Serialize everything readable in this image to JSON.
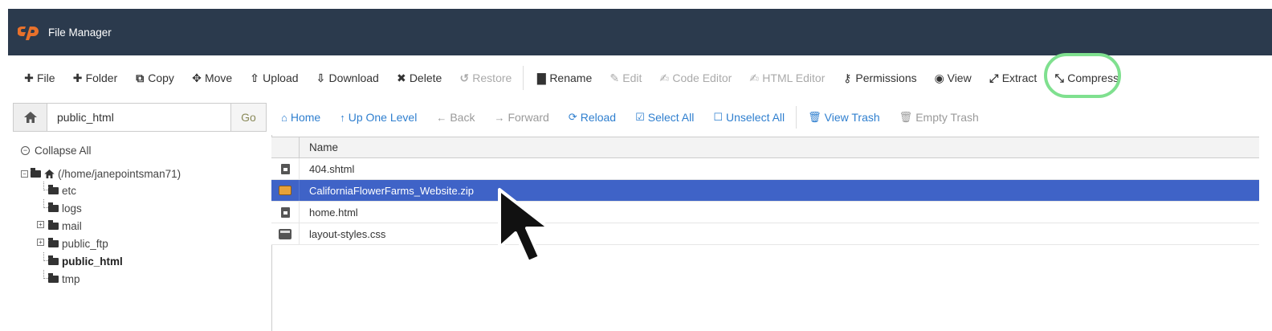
{
  "app": {
    "title": "File Manager"
  },
  "toolbar": {
    "buttons": [
      {
        "label": "File",
        "icon": "plus-icon",
        "enabled": true
      },
      {
        "label": "Folder",
        "icon": "plus-icon",
        "enabled": true
      },
      {
        "label": "Copy",
        "icon": "copy-icon",
        "enabled": true
      },
      {
        "label": "Move",
        "icon": "move-icon",
        "enabled": true
      },
      {
        "label": "Upload",
        "icon": "upload-icon",
        "enabled": true
      },
      {
        "label": "Download",
        "icon": "download-icon",
        "enabled": true
      },
      {
        "label": "Delete",
        "icon": "close-icon",
        "enabled": true
      },
      {
        "label": "Restore",
        "icon": "restore-icon",
        "enabled": false
      },
      {
        "label": "Rename",
        "icon": "file-icon",
        "enabled": true
      },
      {
        "label": "Edit",
        "icon": "pencil-icon",
        "enabled": false
      },
      {
        "label": "Code Editor",
        "icon": "edit-icon",
        "enabled": false
      },
      {
        "label": "HTML Editor",
        "icon": "edit-icon",
        "enabled": false
      },
      {
        "label": "Permissions",
        "icon": "key-icon",
        "enabled": true
      },
      {
        "label": "View",
        "icon": "eye-icon",
        "enabled": true
      },
      {
        "label": "Extract",
        "icon": "expand-icon",
        "enabled": true,
        "highlighted": true,
        "highlight_color": "#7fe08f"
      },
      {
        "label": "Compress",
        "icon": "compress-icon",
        "enabled": true
      }
    ]
  },
  "path_bar": {
    "value": "public_html",
    "go_label": "Go"
  },
  "nav": {
    "buttons": [
      {
        "label": "Home",
        "icon": "home-icon",
        "enabled": true
      },
      {
        "label": "Up One Level",
        "icon": "arrow-up-icon",
        "enabled": true
      },
      {
        "label": "Back",
        "icon": "arrow-left-icon",
        "enabled": false
      },
      {
        "label": "Forward",
        "icon": "arrow-right-icon",
        "enabled": false
      },
      {
        "label": "Reload",
        "icon": "reload-icon",
        "enabled": true
      },
      {
        "label": "Select All",
        "icon": "checkbox-checked-icon",
        "enabled": true
      },
      {
        "label": "Unselect All",
        "icon": "checkbox-empty-icon",
        "enabled": true
      },
      {
        "label": "View Trash",
        "icon": "trash-icon",
        "enabled": true
      },
      {
        "label": "Empty Trash",
        "icon": "trash-icon",
        "enabled": false
      }
    ]
  },
  "tree": {
    "collapse_label": "Collapse All",
    "root_label": "(/home/janepointsman71)",
    "items": [
      {
        "label": "etc",
        "expandable": false,
        "bold": false
      },
      {
        "label": "logs",
        "expandable": false,
        "bold": false
      },
      {
        "label": "mail",
        "expandable": true,
        "bold": false
      },
      {
        "label": "public_ftp",
        "expandable": true,
        "bold": false
      },
      {
        "label": "public_html",
        "expandable": false,
        "bold": true
      },
      {
        "label": "tmp",
        "expandable": false,
        "bold": false
      }
    ]
  },
  "file_table": {
    "columns": [
      "Name"
    ],
    "rows": [
      {
        "name": "404.shtml",
        "icon": "file-icon",
        "selected": false
      },
      {
        "name": "CaliforniaFlowerFarms_Website.zip",
        "icon": "archive-icon",
        "selected": true
      },
      {
        "name": "home.html",
        "icon": "file-icon",
        "selected": false
      },
      {
        "name": "layout-styles.css",
        "icon": "stylesheet-icon",
        "selected": false
      }
    ]
  },
  "colors": {
    "header_bg": "#2b3a4d",
    "brand": "#e8712b",
    "link": "#2f7fcf",
    "selection": "#3f63c7"
  }
}
